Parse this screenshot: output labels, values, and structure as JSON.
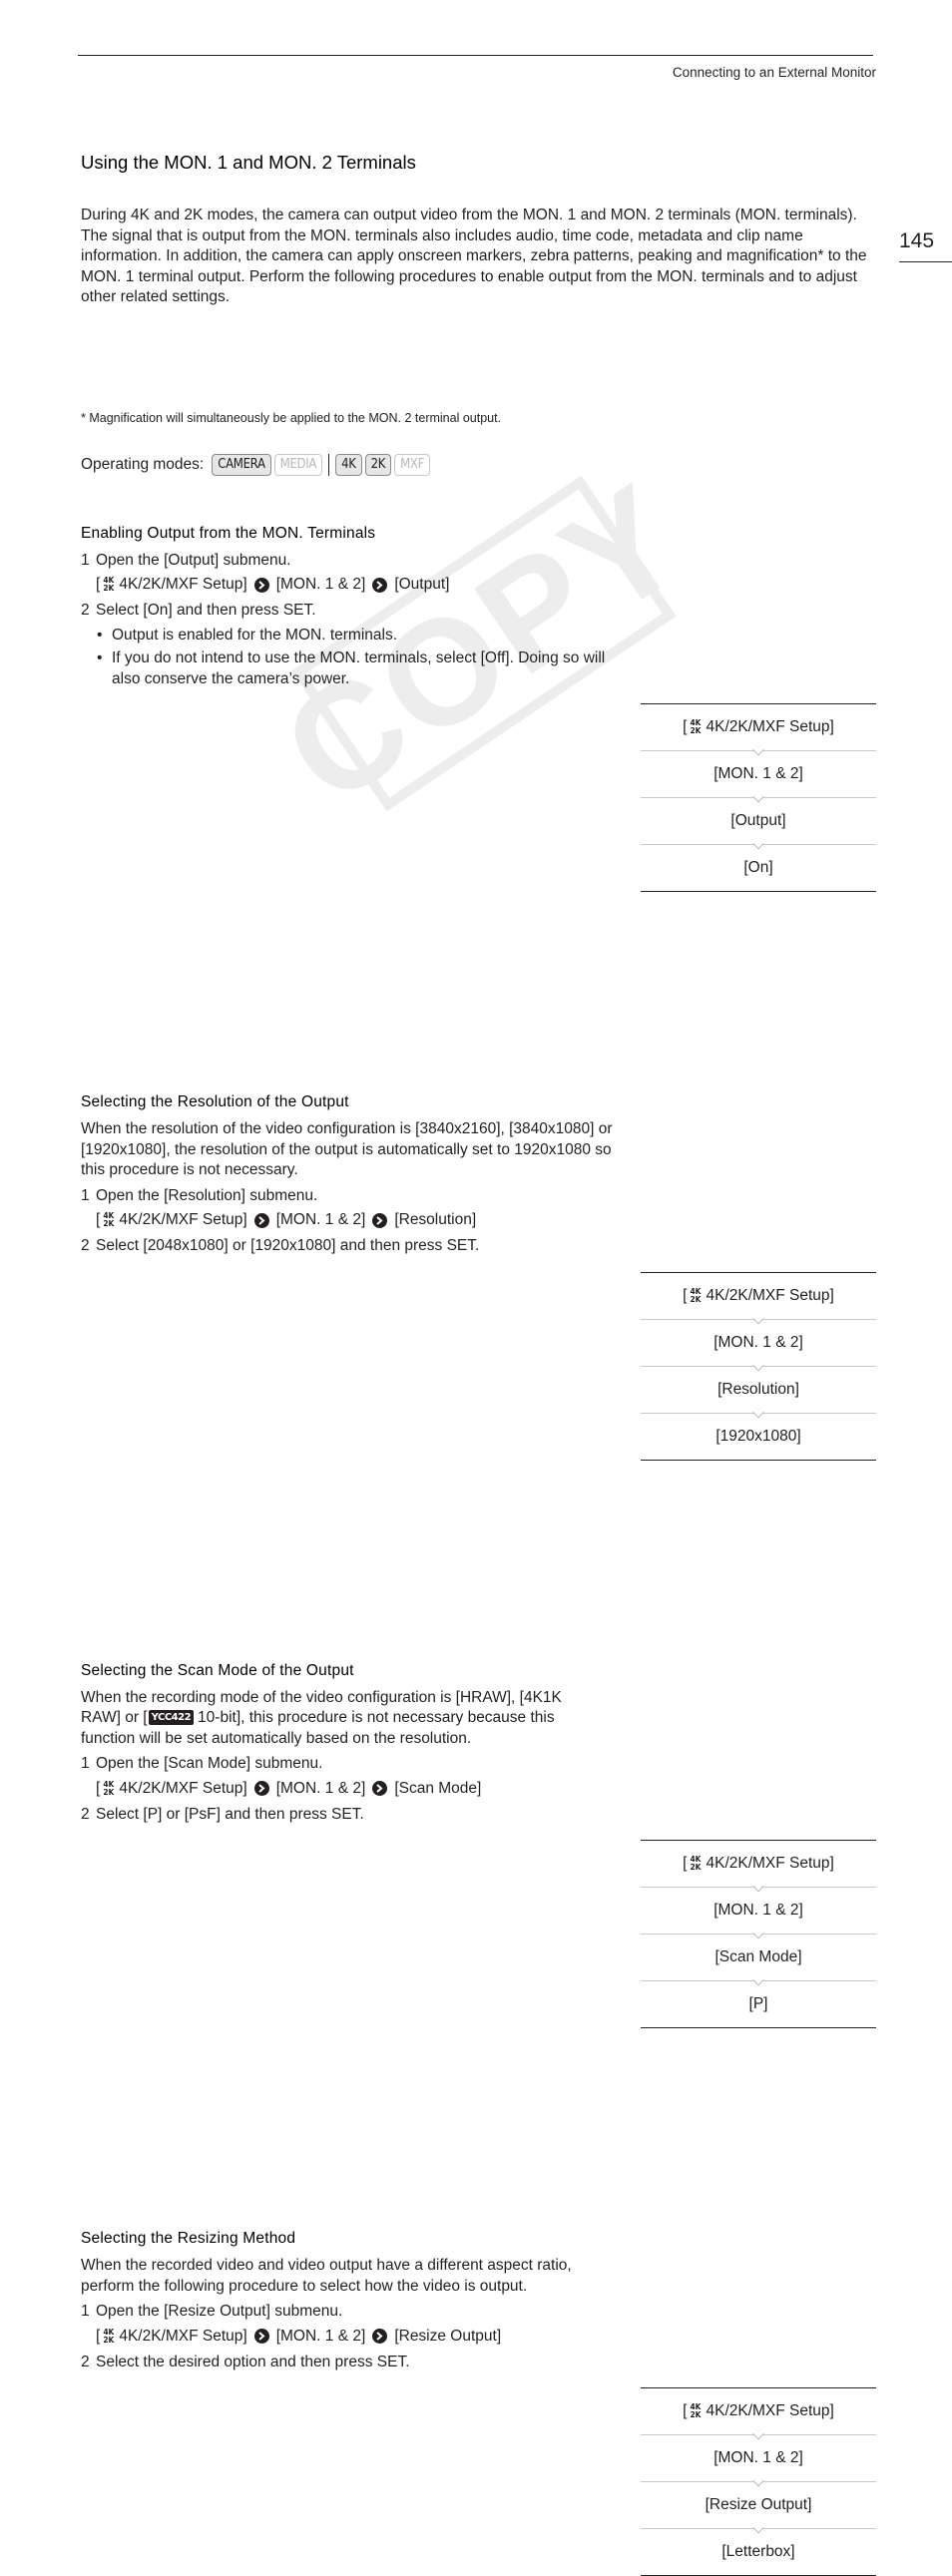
{
  "header": {
    "running_head": "Connecting to an External Monitor",
    "page_number": "145"
  },
  "watermark": "COPY",
  "intro": {
    "title": "Using the MON. 1 and MON. 2 Terminals",
    "body": "During 4K and 2K modes, the camera can output video from the MON. 1 and MON. 2 terminals (MON. terminals). The signal that is output from the MON. terminals also includes audio, time code, metadata and clip name information. In addition, the camera can apply onscreen markers, zebra patterns, peaking and magnification* to the MON. 1 terminal output. Perform the following procedures to enable output from the MON. terminals and to adjust other related settings.",
    "footnote": "* Magnification will simultaneously be applied to the MON. 2 terminal output.",
    "operating_modes_label": "Operating modes:",
    "modes": [
      {
        "label": "CAMERA",
        "active": true
      },
      {
        "label": "MEDIA",
        "active": false
      },
      {
        "label": "4K",
        "active": true
      },
      {
        "label": "2K",
        "active": true
      },
      {
        "label": "MXF",
        "active": false
      }
    ]
  },
  "icons": {
    "setup_icon_top": "4K",
    "setup_icon_bottom": "2K",
    "ycc_icon": "YCC422"
  },
  "sections": [
    {
      "title": "Enabling Output from the MON. Terminals",
      "paragraph": "",
      "step1": "Open the [Output] submenu.",
      "path": [
        "4K/2K/MXF Setup]",
        "[MON. 1 & 2]",
        "[Output]"
      ],
      "step2": "Select [On] and then press SET.",
      "bullets": [
        "Output is enabled for the MON. terminals.",
        "If you do not intend to use the MON. terminals, select [Off]. Doing so will also conserve the camera’s power."
      ],
      "menu": [
        "4K/2K/MXF Setup]",
        "[MON. 1 & 2]",
        "[Output]",
        "[On]"
      ]
    },
    {
      "title": "Selecting the Resolution of the Output",
      "paragraph": "When the resolution of the video configuration is [3840x2160], [3840x1080] or [1920x1080], the resolution of the output is automatically set to 1920x1080 so this procedure is not necessary.",
      "step1": "Open the [Resolution] submenu.",
      "path": [
        "4K/2K/MXF Setup]",
        "[MON. 1 & 2]",
        "[Resolution]"
      ],
      "step2": "Select [2048x1080] or [1920x1080] and then press SET.",
      "menu": [
        "4K/2K/MXF Setup]",
        "[MON. 1 & 2]",
        "[Resolution]",
        "[1920x1080]"
      ]
    },
    {
      "title": "Selecting the Scan Mode of the Output",
      "paragraph_before_icon": "When the recording mode of the video configuration is [HRAW], [4K1K RAW] or [",
      "paragraph_after_icon": "10-bit], this procedure is not necessary because this function will be set automatically based on the resolution.",
      "step1": "Open the [Scan Mode] submenu.",
      "path": [
        "4K/2K/MXF Setup]",
        "[MON. 1 & 2]",
        "[Scan Mode]"
      ],
      "step2": "Select [P] or [PsF] and then press SET.",
      "menu": [
        "4K/2K/MXF Setup]",
        "[MON. 1 & 2]",
        "[Scan Mode]",
        "[P]"
      ]
    },
    {
      "title": "Selecting the Resizing Method",
      "paragraph": "When the recorded video and video output have a different aspect ratio, perform the following procedure to select how the video is output.",
      "step1": "Open the [Resize Output] submenu.",
      "path": [
        "4K/2K/MXF Setup]",
        "[MON. 1 & 2]",
        "[Resize Output]"
      ],
      "step2": "Select the desired option and then press SET.",
      "menu": [
        "4K/2K/MXF Setup]",
        "[MON. 1 & 2]",
        "[Resize Output]",
        "[Letterbox]"
      ]
    }
  ],
  "step_numbers": [
    "1",
    "2"
  ],
  "bracket_open": "["
}
